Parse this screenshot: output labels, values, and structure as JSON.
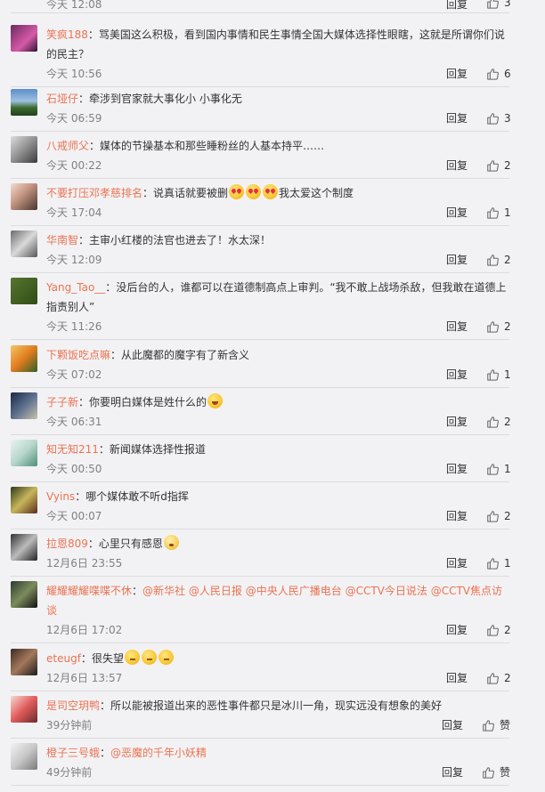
{
  "top_fragment": {
    "time": "今天 12:08",
    "reply": "回复",
    "likes": "3"
  },
  "reply_label": "回复",
  "comments": [
    {
      "user": "笑疯188",
      "segments": [
        {
          "t": "text",
          "v": "骂美国这么积极，看到国内事情和民生事情全国大媒体选择性眼瞎，这就是所谓你们说的民主？"
        }
      ],
      "time": "今天 10:56",
      "likes": "6"
    },
    {
      "user": "石垭仔",
      "segments": [
        {
          "t": "text",
          "v": "牵涉到官家就大事化小 小事化无"
        }
      ],
      "time": "今天 06:59",
      "likes": "3"
    },
    {
      "user": "八戒师父",
      "segments": [
        {
          "t": "text",
          "v": "媒体的节操基本和那些睡粉丝的人基本持平……"
        }
      ],
      "time": "今天 00:22",
      "likes": "2"
    },
    {
      "user": "不要打压邓孝慈排名",
      "segments": [
        {
          "t": "text",
          "v": "说真话就要被删"
        },
        {
          "t": "emoji",
          "v": "heart"
        },
        {
          "t": "emoji",
          "v": "heart"
        },
        {
          "t": "emoji",
          "v": "heart"
        },
        {
          "t": "text",
          "v": "我太爱这个制度"
        }
      ],
      "time": "今天 17:04",
      "likes": "1"
    },
    {
      "user": "华南智",
      "segments": [
        {
          "t": "text",
          "v": "主审小红楼的法官也进去了！水太深！"
        }
      ],
      "time": "今天 12:09",
      "likes": "2"
    },
    {
      "user": "Yang_Tao__",
      "segments": [
        {
          "t": "text",
          "v": "没后台的人，谁都可以在道德制高点上审判。“我不敢上战场杀敌，但我敢在道德上指责别人”"
        }
      ],
      "time": "今天 11:26",
      "likes": "2"
    },
    {
      "user": "下颗饭吃点嘛",
      "segments": [
        {
          "t": "text",
          "v": "从此魔都的魔字有了新含义"
        }
      ],
      "time": "今天 07:02",
      "likes": "1"
    },
    {
      "user": "子子新",
      "segments": [
        {
          "t": "text",
          "v": "你要明白媒体是姓什么的"
        },
        {
          "t": "emoji",
          "v": "laugh"
        }
      ],
      "time": "今天 06:31",
      "likes": "2"
    },
    {
      "user": "知无知211",
      "segments": [
        {
          "t": "text",
          "v": "新闻媒体选择性报道"
        }
      ],
      "time": "今天 00:50",
      "likes": "1"
    },
    {
      "user": "Vyins",
      "segments": [
        {
          "t": "text",
          "v": "哪个媒体敢不听d指挥"
        }
      ],
      "time": "今天 00:07",
      "likes": "2"
    },
    {
      "user": "拉恩809",
      "segments": [
        {
          "t": "text",
          "v": "心里只有感恩"
        },
        {
          "t": "emoji",
          "v": "cat"
        }
      ],
      "time": "12月6日 23:55",
      "likes": "1"
    },
    {
      "user": "耀耀耀耀喋喋不休",
      "segments": [
        {
          "t": "mention",
          "v": "@新华社"
        },
        {
          "t": "text",
          "v": " "
        },
        {
          "t": "mention",
          "v": "@人民日报"
        },
        {
          "t": "text",
          "v": " "
        },
        {
          "t": "mention",
          "v": "@中央人民广播电台"
        },
        {
          "t": "text",
          "v": " "
        },
        {
          "t": "mention",
          "v": "@CCTV今日说法"
        },
        {
          "t": "text",
          "v": " "
        },
        {
          "t": "mention",
          "v": "@CCTV焦点访谈"
        }
      ],
      "time": "12月6日 17:02",
      "likes": "2"
    },
    {
      "user": "eteugf",
      "segments": [
        {
          "t": "text",
          "v": "很失望"
        },
        {
          "t": "emoji",
          "v": "think"
        },
        {
          "t": "emoji",
          "v": "think"
        },
        {
          "t": "emoji",
          "v": "think"
        }
      ],
      "time": "12月6日 13:57",
      "likes": "2"
    },
    {
      "user": "是司空玥鸭",
      "segments": [
        {
          "t": "text",
          "v": "所以能被报道出来的恶性事件都只是冰川一角，现实远没有想象的美好"
        }
      ],
      "time": "39分钟前",
      "likes": "赞"
    },
    {
      "user": "橙子三号蛾",
      "segments": [
        {
          "t": "mention",
          "v": "@恶魔的千年小妖精"
        }
      ],
      "time": "49分钟前",
      "likes": "赞"
    }
  ],
  "colors": {
    "username": "#eb7350",
    "background": "#f2f2f5",
    "divider": "#dcdcdf",
    "meta": "#808080"
  }
}
